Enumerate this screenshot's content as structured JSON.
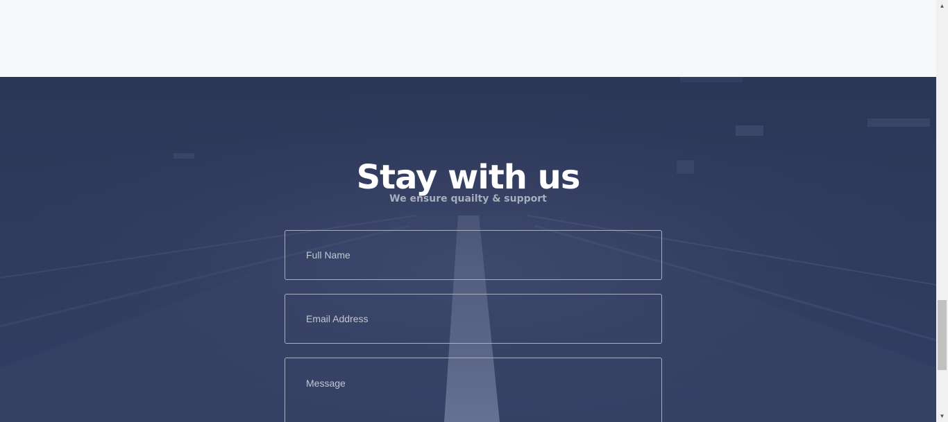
{
  "contact": {
    "title": "Stay with us",
    "subtitle": "We ensure quailty & support",
    "full_name_placeholder": "Full Name",
    "email_placeholder": "Email Address",
    "message_placeholder": "Message"
  },
  "colors": {
    "top_background": "#f5f9fa",
    "overlay": "#2f3a5c",
    "title": "#ffffff",
    "subtitle": "#a9aebd",
    "field_border": "#a9afc0"
  },
  "icons": {
    "scroll_up": "▲",
    "scroll_down": "▼"
  }
}
